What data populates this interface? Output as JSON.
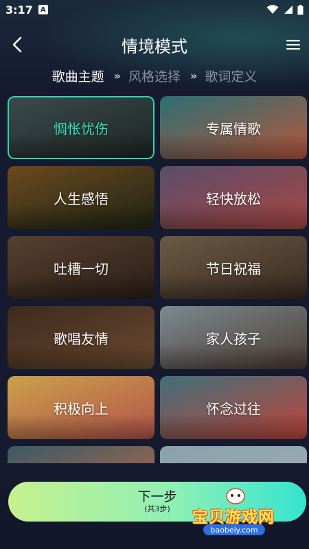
{
  "status": {
    "time": "3:17",
    "notif_glyph": "A"
  },
  "header": {
    "title": "情境模式"
  },
  "steps": [
    {
      "label": "歌曲主题",
      "active": true
    },
    {
      "label": "风格选择",
      "active": false
    },
    {
      "label": "歌词定义",
      "active": false
    }
  ],
  "step_separator": "»",
  "themes": [
    {
      "label": "惆怅忧伤",
      "selected": true,
      "colors": [
        "#3b4a4c",
        "#1e2524"
      ]
    },
    {
      "label": "专属情歌",
      "selected": false,
      "colors": [
        "#2b6f74",
        "#b9573c"
      ]
    },
    {
      "label": "人生感悟",
      "selected": false,
      "colors": [
        "#6a4a1e",
        "#202416"
      ]
    },
    {
      "label": "轻快放松",
      "selected": false,
      "colors": [
        "#5a4c6a",
        "#a84842"
      ]
    },
    {
      "label": "吐槽一切",
      "selected": false,
      "colors": [
        "#57402e",
        "#2a1e18"
      ]
    },
    {
      "label": "节日祝福",
      "selected": false,
      "colors": [
        "#6b5a44",
        "#3a2a20"
      ]
    },
    {
      "label": "歌唱友情",
      "selected": false,
      "colors": [
        "#3e2a1e",
        "#6a4a30"
      ]
    },
    {
      "label": "家人孩子",
      "selected": false,
      "colors": [
        "#7b8a8e",
        "#4d3c34"
      ]
    },
    {
      "label": "积极向上",
      "selected": false,
      "colors": [
        "#caa04a",
        "#b4544a"
      ]
    },
    {
      "label": "怀念过往",
      "selected": false,
      "colors": [
        "#40707a",
        "#c0443a"
      ]
    },
    {
      "label": "",
      "selected": false,
      "colors": [
        "#3a5a66",
        "#c26a44"
      ]
    },
    {
      "label": "",
      "selected": false,
      "colors": [
        "#8aa0aa",
        "#a0b0b8"
      ]
    }
  ],
  "next_button": {
    "label": "下一步",
    "sub": "(共3步)"
  },
  "watermark": {
    "text": "宝贝游戏网",
    "url": "baobeiy.com"
  }
}
